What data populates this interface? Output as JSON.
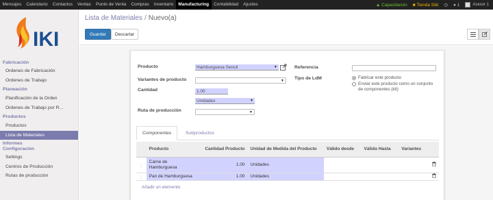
{
  "topbar": {
    "menu": [
      "Mensajes",
      "Calendario",
      "Contactos",
      "Ventas",
      "Punto de Venta",
      "Compras",
      "Inventario",
      "Manufacturing",
      "Contabilidad",
      "Ajustes"
    ],
    "active_index": 7,
    "capacitacion": "Capacitación",
    "tienda": "Tienda Siki",
    "chat_count": "1",
    "user": "Asesor 1"
  },
  "sidebar": {
    "logo_text": "IKI",
    "sections": [
      {
        "title": "Fabricación",
        "items": [
          "Ordenes de Fabricación",
          "Ordenes de Trabajo"
        ]
      },
      {
        "title": "Planeación",
        "items": [
          "Planificación de la Orden",
          "Ordenes de Trabajo por R..."
        ]
      },
      {
        "title": "Productos",
        "items": [
          "Productos",
          "Lista de Materiales"
        ]
      },
      {
        "title": "Informes",
        "items": []
      },
      {
        "title": "Configuración",
        "items": [
          "Settings",
          "Centros de Producción",
          "Rutas de producción"
        ]
      }
    ],
    "active_item": "Lista de Materiales"
  },
  "breadcrumb": {
    "parent": "Lista de Materiales",
    "separator": "/",
    "current": "Nuevo(a)"
  },
  "buttons": {
    "save": "Guardar",
    "discard": "Descartar"
  },
  "form": {
    "producto_label": "Producto",
    "producto_value": "Hamburguesa Sencil",
    "variantes_label": "Variantes de producto",
    "variantes_value": "",
    "cantidad_label": "Cantidad",
    "cantidad_value": "1.00",
    "uom_value": "Unidades",
    "ruta_label": "Ruta de producción",
    "ruta_value": "",
    "referencia_label": "Referencia",
    "referencia_value": "",
    "tipo_label": "Tipo de LdM",
    "tipo_options": [
      "Fabricar este producto",
      "Enviar este producto como un conjunto de componentes (kit)"
    ],
    "tipo_selected": 0
  },
  "tabs": [
    "Componentes",
    "Subproductos"
  ],
  "table": {
    "headers": [
      "Producto",
      "Cantidad Producto",
      "Unidad de Medida del Producto",
      "Válido desde",
      "Válido Hasta",
      "Variantes"
    ],
    "rows": [
      {
        "producto": "Carne de Hamburguesa",
        "cantidad": "1.00",
        "uom": "Unidades"
      },
      {
        "producto": "Pan de Hamburguesa",
        "cantidad": "1.00",
        "uom": "Unidades"
      }
    ],
    "add_line": "Añadir un elemento"
  },
  "colors": {
    "accent": "#7c7bad",
    "required_field": "#d2d2ff",
    "primary_button": "#337ab7",
    "topbar": "#222222"
  }
}
